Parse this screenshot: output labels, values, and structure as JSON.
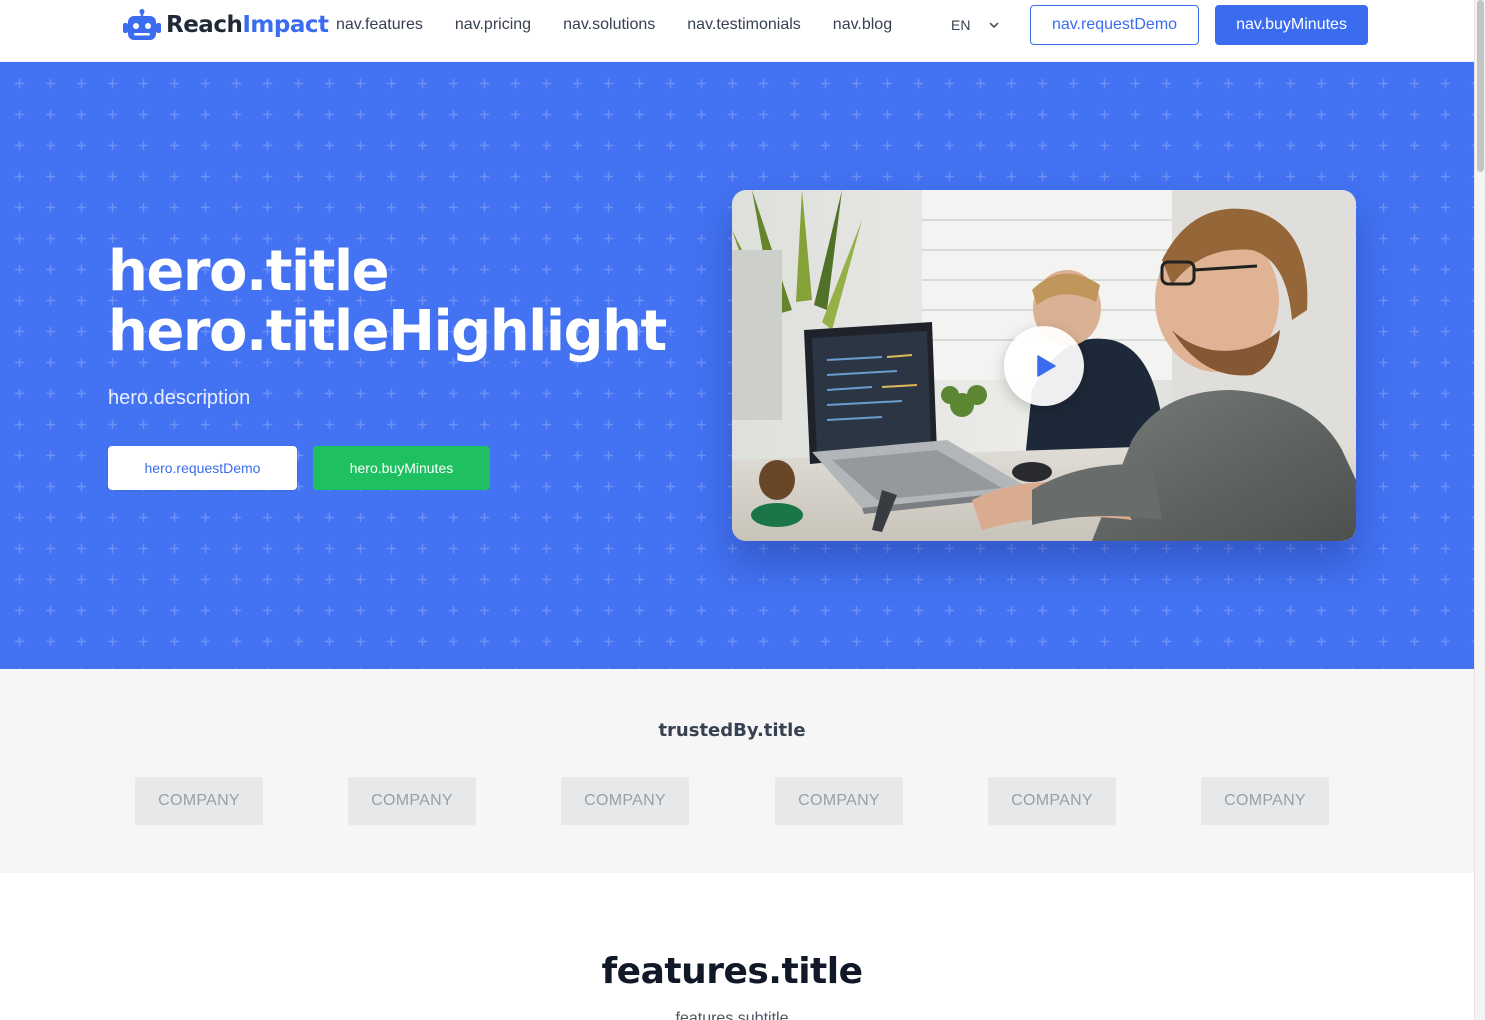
{
  "brand": {
    "name_part1": "Reach",
    "name_part2": "Impact",
    "icon": "robot-icon",
    "colors": {
      "primary": "#3b6cf0",
      "hero_bg": "#4372f2",
      "success": "#1fc060"
    }
  },
  "nav": {
    "links": [
      "nav.features",
      "nav.pricing",
      "nav.solutions",
      "nav.testimonials",
      "nav.blog"
    ],
    "language": "EN",
    "language_icon": "chevron-down-icon",
    "request_demo": "nav.requestDemo",
    "buy_minutes": "nav.buyMinutes"
  },
  "hero": {
    "title": "hero.title",
    "title_highlight": "hero.titleHighlight",
    "description": "hero.description",
    "request_demo": "hero.requestDemo",
    "buy_minutes": "hero.buyMinutes",
    "video_icon": "play-icon"
  },
  "trusted": {
    "title": "trustedBy.title",
    "companies": [
      "COMPANY",
      "COMPANY",
      "COMPANY",
      "COMPANY",
      "COMPANY",
      "COMPANY"
    ]
  },
  "features": {
    "title": "features.title",
    "subtitle": "features.subtitle"
  }
}
